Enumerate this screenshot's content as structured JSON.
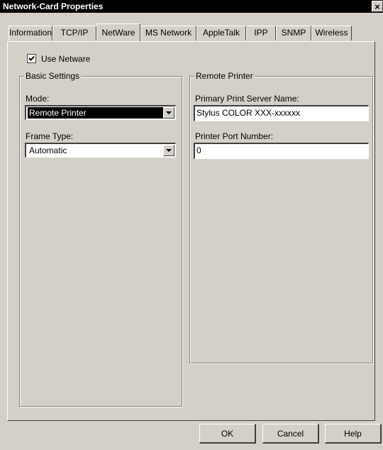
{
  "window": {
    "title": "Network-Card Properties",
    "close_glyph": "×"
  },
  "tabs": [
    {
      "label": "Information",
      "active": false
    },
    {
      "label": "TCP/IP",
      "active": false
    },
    {
      "label": "NetWare",
      "active": true
    },
    {
      "label": "MS Network",
      "active": false
    },
    {
      "label": "AppleTalk",
      "active": false
    },
    {
      "label": "IPP",
      "active": false
    },
    {
      "label": "SNMP",
      "active": false
    },
    {
      "label": "Wireless",
      "active": false
    }
  ],
  "use_netware": {
    "label": "Use Netware",
    "checked": true
  },
  "basic_settings": {
    "title": "Basic Settings",
    "mode_label": "Mode:",
    "mode_value": "Remote Printer",
    "frame_type_label": "Frame Type:",
    "frame_type_value": "Automatic"
  },
  "remote_printer": {
    "title": "Remote Printer",
    "server_name_label": "Primary Print Server Name:",
    "server_name_value": "Stylus COLOR XXX-xxxxxx",
    "port_label": "Printer Port Number:",
    "port_value": "0"
  },
  "buttons": {
    "ok": "OK",
    "cancel": "Cancel",
    "help": "Help"
  },
  "icons": {
    "check": "checkmark-icon",
    "dropdown": "chevron-down-icon",
    "close": "close-icon"
  }
}
